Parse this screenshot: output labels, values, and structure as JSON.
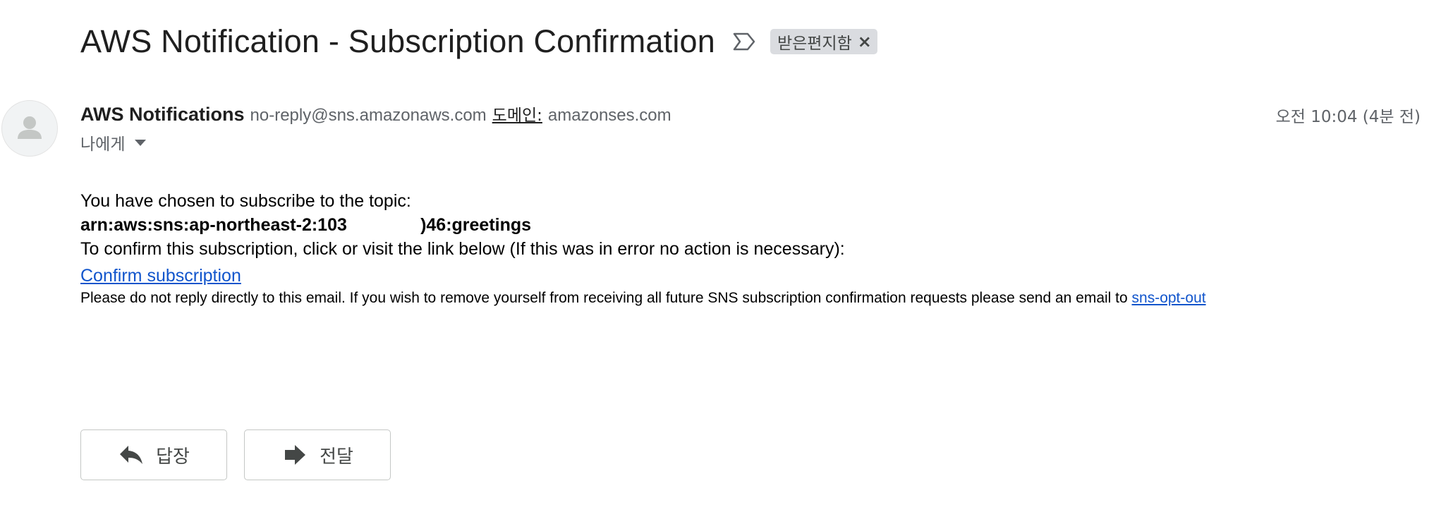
{
  "header": {
    "subject": "AWS Notification - Subscription Confirmation",
    "label_chip": "받은편지함",
    "label_close": "×"
  },
  "sender": {
    "name": "AWS Notifications",
    "email": "no-reply@sns.amazonaws.com",
    "domain_label": "도메인:",
    "domain_value": "amazonses.com",
    "timestamp": "오전 10:04 (4분 전)",
    "to": "나에게"
  },
  "body": {
    "intro": "You have chosen to subscribe to the topic:",
    "topic_arn": "arn:aws:sns:ap-northeast-2:103               )46:greetings",
    "confirm_instruction": "To confirm this subscription, click or visit the link below (If this was in error no action is necessary):",
    "confirm_link": "Confirm subscription",
    "note": "Please do not reply directly to this email. If you wish to remove yourself from receiving all future SNS subscription confirmation requests please send an email to ",
    "opt_out_link": "sns-opt-out"
  },
  "actions": {
    "reply_label": "답장",
    "forward_label": "전달"
  },
  "icons": {
    "important_marker": "important-marker-icon",
    "avatar": "person-avatar-icon",
    "reply": "reply-arrow-icon",
    "forward": "forward-arrow-icon"
  },
  "colors": {
    "link": "#1155cc",
    "muted_text": "#5f6368",
    "chip_bg": "#dadce0"
  }
}
